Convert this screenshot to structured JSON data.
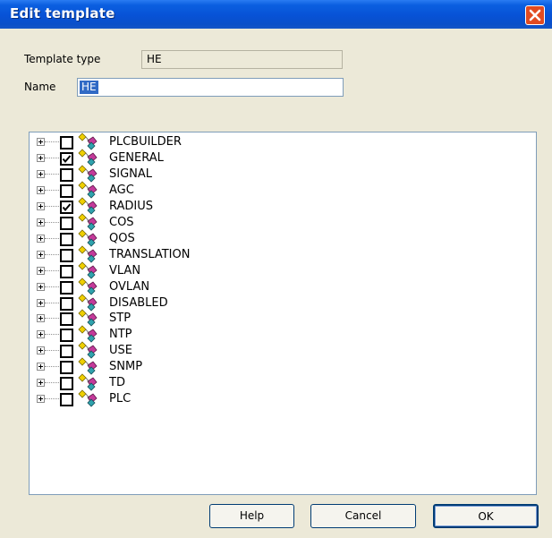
{
  "window": {
    "title": "Edit template"
  },
  "fields": {
    "template_type_label": "Template type",
    "template_type_value": "HE",
    "name_label": "Name",
    "name_value": "HE"
  },
  "tree": {
    "items": [
      {
        "label": "PLCBUILDER",
        "checked": false
      },
      {
        "label": "GENERAL",
        "checked": true
      },
      {
        "label": "SIGNAL",
        "checked": false
      },
      {
        "label": "AGC",
        "checked": false
      },
      {
        "label": "RADIUS",
        "checked": true
      },
      {
        "label": "COS",
        "checked": false
      },
      {
        "label": "QOS",
        "checked": false
      },
      {
        "label": "TRANSLATION",
        "checked": false
      },
      {
        "label": "VLAN",
        "checked": false
      },
      {
        "label": "OVLAN",
        "checked": false
      },
      {
        "label": "DISABLED",
        "checked": false
      },
      {
        "label": "STP",
        "checked": false
      },
      {
        "label": "NTP",
        "checked": false
      },
      {
        "label": "USE",
        "checked": false
      },
      {
        "label": "SNMP",
        "checked": false
      },
      {
        "label": "TD",
        "checked": false
      },
      {
        "label": "PLC",
        "checked": false
      }
    ]
  },
  "buttons": {
    "help": "Help",
    "cancel": "Cancel",
    "ok": "OK"
  }
}
